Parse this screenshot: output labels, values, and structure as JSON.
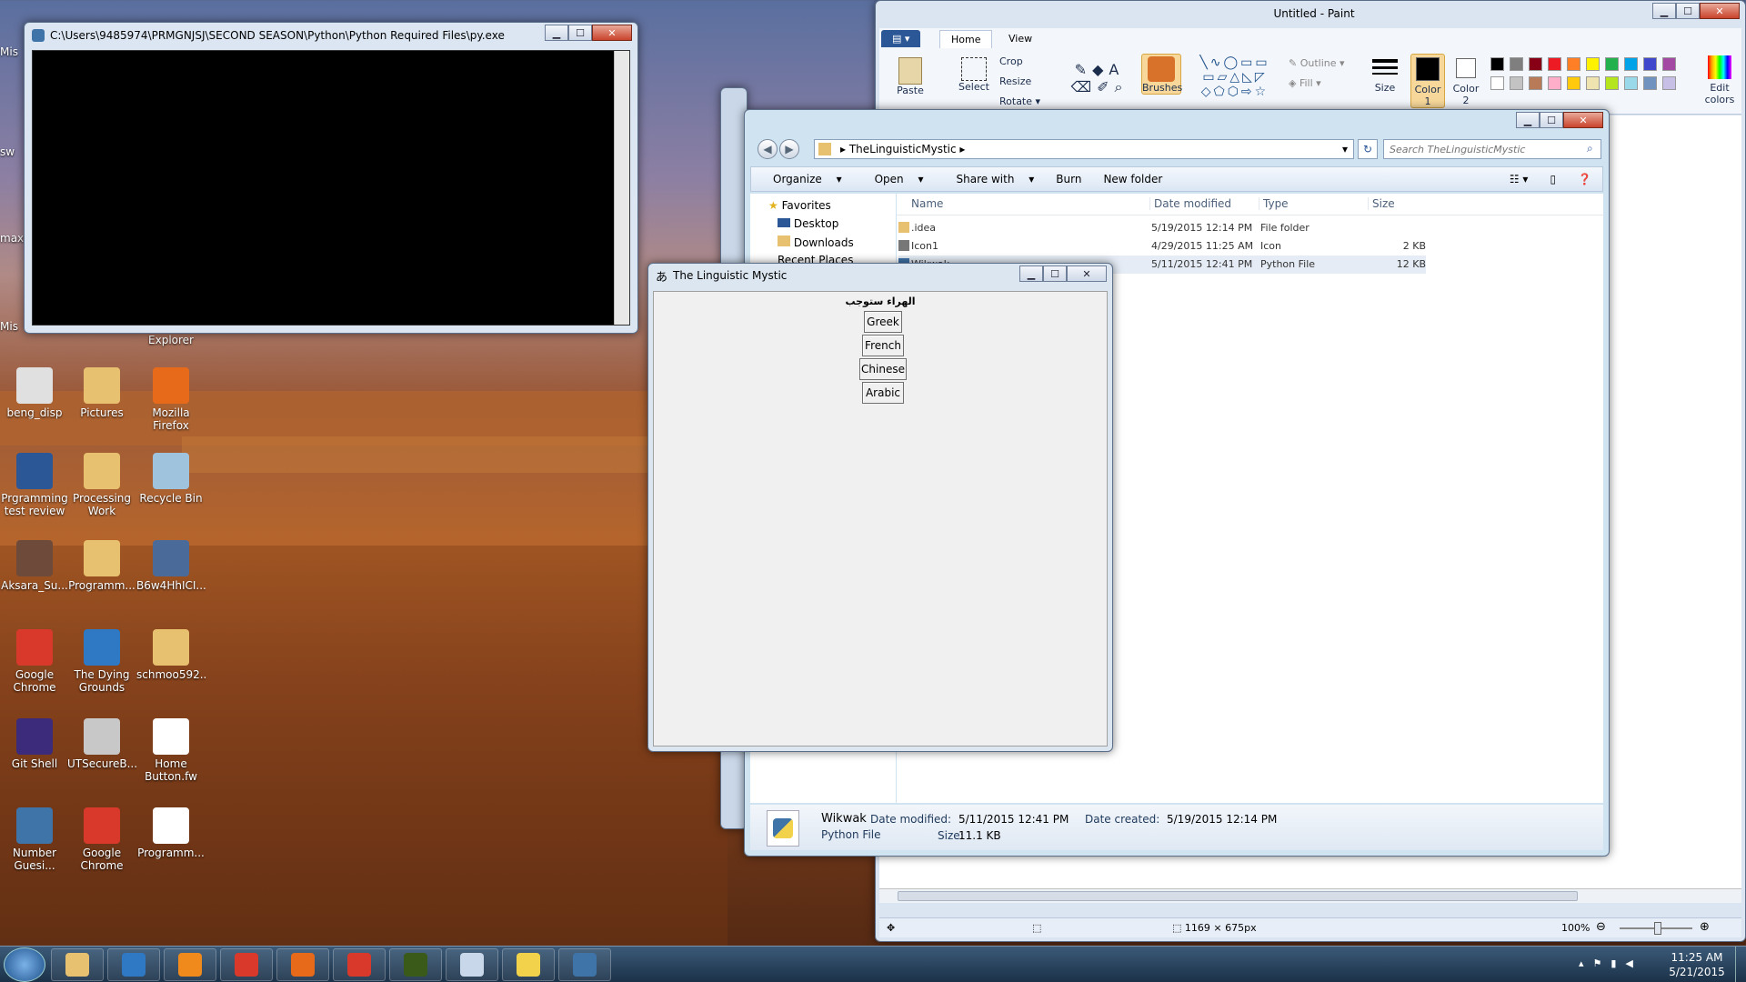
{
  "desktop": {
    "icons": [
      {
        "label": "beng_disp",
        "color": "#e0e0e0"
      },
      {
        "label": "Pictures",
        "color": "#e8c170"
      },
      {
        "label": "Mozilla Firefox",
        "color": "#e66a1a"
      },
      {
        "label": "Prgramming test review",
        "color": "#2b5797"
      },
      {
        "label": "Processing Work",
        "color": "#e8c170"
      },
      {
        "label": "Recycle Bin",
        "color": "#9fc3dd"
      },
      {
        "label": "Aksara_Su...",
        "color": "#6d4a3a"
      },
      {
        "label": "Programm...",
        "color": "#e8c170"
      },
      {
        "label": "B6w4HhICI...",
        "color": "#4a6a9a"
      },
      {
        "label": "Google Chrome",
        "color": "#d8392b"
      },
      {
        "label": "The Dying Grounds",
        "color": "#2f78c4"
      },
      {
        "label": "schmoo592...",
        "color": "#e8c170"
      },
      {
        "label": "Git Shell",
        "color": "#3c2a7a"
      },
      {
        "label": "UTSecureB...",
        "color": "#c8c8c8"
      },
      {
        "label": "Home Button.fw",
        "color": "#ffffff"
      },
      {
        "label": "Number Guesi...",
        "color": "#3e74a8"
      },
      {
        "label": "Google Chrome",
        "color": "#d8392b"
      },
      {
        "label": "Programm...",
        "color": "#ffffff"
      }
    ],
    "partial_labels": [
      "Mis",
      "sw",
      "max",
      "Mis",
      "Explorer"
    ]
  },
  "cmd_window": {
    "title": "C:\\Users\\9485974\\PRMGNJSJ\\SECOND SEASON\\Python\\Python Required Files\\py.exe"
  },
  "paint": {
    "title": "Untitled - Paint",
    "tabs": [
      "Home",
      "View"
    ],
    "clipboard": {
      "paste": "Paste"
    },
    "image": {
      "select": "Select",
      "crop": "Crop",
      "resize": "Resize",
      "rotate": "Rotate"
    },
    "brushes": "Brushes",
    "shapes": {
      "outline": "Outline",
      "fill": "Fill"
    },
    "size": "Size",
    "color1": "Color 1",
    "color2": "Color 2",
    "edit_colors": "Edit colors",
    "palette": [
      "#000000",
      "#7f7f7f",
      "#880015",
      "#ed1c24",
      "#ff7f27",
      "#fff200",
      "#22b14c",
      "#00a2e8",
      "#3f48cc",
      "#a349a4",
      "#ffffff",
      "#c3c3c3",
      "#b97a57",
      "#ffaec9",
      "#ffc90e",
      "#efe4b0",
      "#b5e61d",
      "#99d9ea",
      "#7092be",
      "#c8bfe7"
    ],
    "status": {
      "dimensions": "1169 × 675px",
      "zoom": "100%"
    }
  },
  "explorer": {
    "breadcrumb": "TheLinguisticMystic",
    "search_placeholder": "Search TheLinguisticMystic",
    "toolbar": {
      "organize": "Organize",
      "open": "Open",
      "share": "Share with",
      "burn": "Burn",
      "new_folder": "New folder"
    },
    "nav": {
      "favorites": "Favorites",
      "desktop": "Desktop",
      "downloads": "Downloads",
      "recent": "Recent Places"
    },
    "columns": {
      "name": "Name",
      "date": "Date modified",
      "type": "Type",
      "size": "Size"
    },
    "files": [
      {
        "name": ".idea",
        "date": "5/19/2015 12:14 PM",
        "type": "File folder",
        "size": ""
      },
      {
        "name": "Icon1",
        "date": "4/29/2015 11:25 AM",
        "type": "Icon",
        "size": "2 KB"
      },
      {
        "name": "Wikwak",
        "date": "5/11/2015 12:41 PM",
        "type": "Python File",
        "size": "12 KB"
      }
    ],
    "details": {
      "name": "Wikwak",
      "kind": "Python File",
      "modified_label": "Date modified:",
      "modified": "5/11/2015 12:41 PM",
      "created_label": "Date created:",
      "created": "5/19/2015 12:14 PM",
      "size_label": "Size:",
      "size": "11.1 KB"
    }
  },
  "tk_window": {
    "title": "The Linguistic Mystic",
    "label": "الهراء ستوجب",
    "buttons": [
      "Greek",
      "French",
      "Chinese",
      "Arabic"
    ]
  },
  "taskbar": {
    "items": [
      {
        "name": "explorer",
        "color": "#e8c170"
      },
      {
        "name": "ie",
        "color": "#2f78c4"
      },
      {
        "name": "media",
        "color": "#f08a1c"
      },
      {
        "name": "chrome",
        "color": "#d8392b"
      },
      {
        "name": "firefox",
        "color": "#e66a1a"
      },
      {
        "name": "b-app",
        "color": "#d8392b"
      },
      {
        "name": "dreamweaver",
        "color": "#3a5a1a"
      },
      {
        "name": "paint",
        "color": "#c8d8ea"
      },
      {
        "name": "python",
        "color": "#f2d24a"
      },
      {
        "name": "python-console",
        "color": "#3e74a8"
      }
    ],
    "time": "11:25 AM",
    "date": "5/21/2015"
  }
}
